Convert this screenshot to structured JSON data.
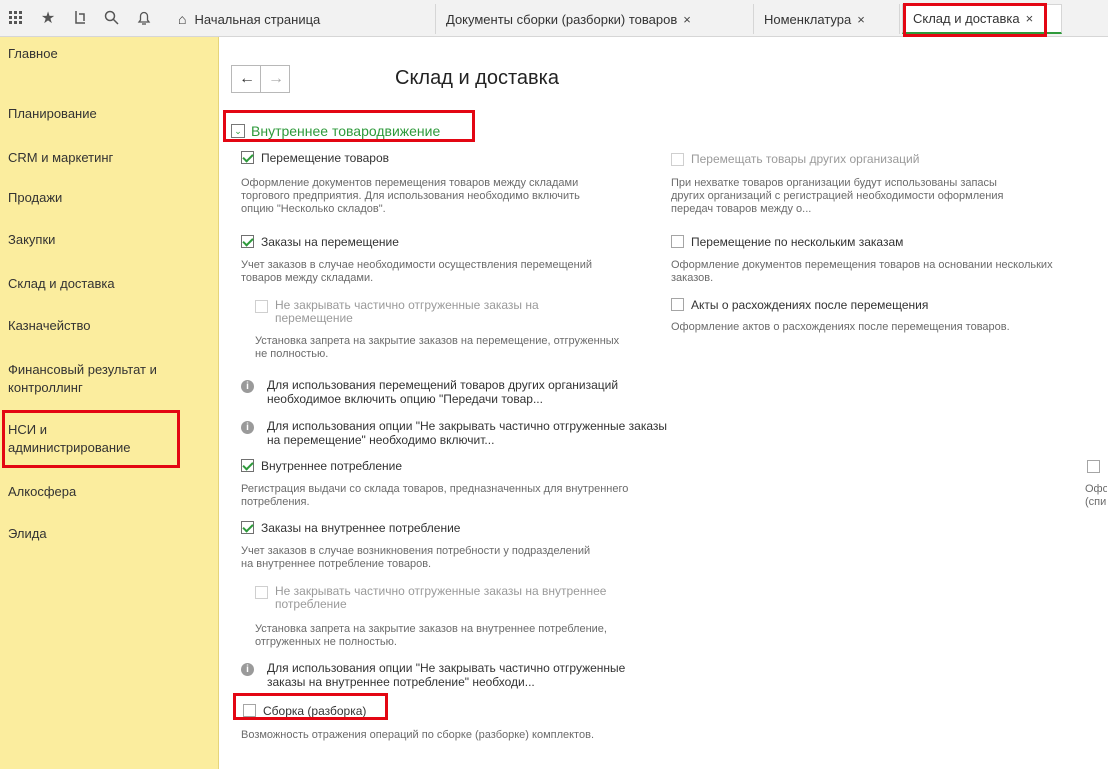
{
  "topbar": {
    "tabs": [
      {
        "label": "Начальная страница",
        "close": ""
      },
      {
        "label": "Документы сборки (разборки) товаров",
        "close": "×"
      },
      {
        "label": "Номенклатура",
        "close": "×"
      },
      {
        "label": "Склад и доставка",
        "close": "×"
      }
    ],
    "icons": {
      "apps": "apps-grid-icon",
      "favorites": "star-icon",
      "history": "history-icon",
      "search": "search-icon",
      "notifications": "bell-icon",
      "home": "home-icon"
    }
  },
  "sidebar": {
    "items": [
      "Главное",
      "Планирование",
      "CRM и маркетинг",
      "Продажи",
      "Закупки",
      "Склад и доставка",
      "Казначейство",
      "Финансовый результат и контроллинг",
      "НСИ и администрирование",
      "Алкосфера",
      "Элида"
    ]
  },
  "main": {
    "title": "Склад и доставка",
    "section": "Внутреннее товародвижение",
    "left": {
      "move_goods": {
        "label": "Перемещение товаров",
        "desc": "Оформление документов перемещения товаров между складами торгового предприятия. Для использования необходимо включить опцию \"Несколько складов\"."
      },
      "move_orders": {
        "label": "Заказы на перемещение",
        "desc": "Учет заказов в случае необходимости осуществления перемещений товаров между складами."
      },
      "no_close_move": {
        "label": "Не закрывать частично отгруженные заказы на перемещение",
        "desc": "Установка запрета на закрытие заказов на перемещение, отгруженных не полностью."
      },
      "info1": "Для использования перемещений товаров других организаций необходимое включить опцию \"Передачи товар...",
      "info2": "Для использования опции \"Не закрывать частично отгруженные заказы на перемещение\" необходимо включит...",
      "internal_use": {
        "label": "Внутреннее потребление",
        "desc": "Регистрация выдачи со склада товаров, предназначенных для внутреннего потребления."
      },
      "internal_orders": {
        "label": "Заказы на внутреннее потребление",
        "desc": "Учет заказов в случае возникновения потребности у подразделений на внутреннее потребление товаров."
      },
      "no_close_internal": {
        "label": "Не закрывать частично отгруженные заказы на внутреннее потребление",
        "desc": "Установка запрета на закрытие заказов на внутреннее потребление, отгруженных не полностью."
      },
      "info3": "Для использования опции \"Не закрывать частично отгруженные заказы на внутреннее потребление\" необходи...",
      "assembly": {
        "label": "Сборка (разборка)",
        "desc": "Возможность отражения операций по сборке (разборке) комплектов."
      }
    },
    "right": {
      "other_orgs": {
        "label": "Перемещать товары других организаций",
        "desc": "При нехватке товаров организации будут использованы запасы других организаций с регистрацией необходимости оформления передач товаров между о..."
      },
      "multi_orders": {
        "label": "Перемещение по нескольким заказам",
        "desc": "Оформление документов перемещения товаров на основании нескольких заказов."
      },
      "discrepancy": {
        "label": "Акты о расхождениях после перемещения",
        "desc": "Оформление актов о расхождениях после перемещения товаров."
      },
      "edge_text": "Офо (спи"
    }
  }
}
